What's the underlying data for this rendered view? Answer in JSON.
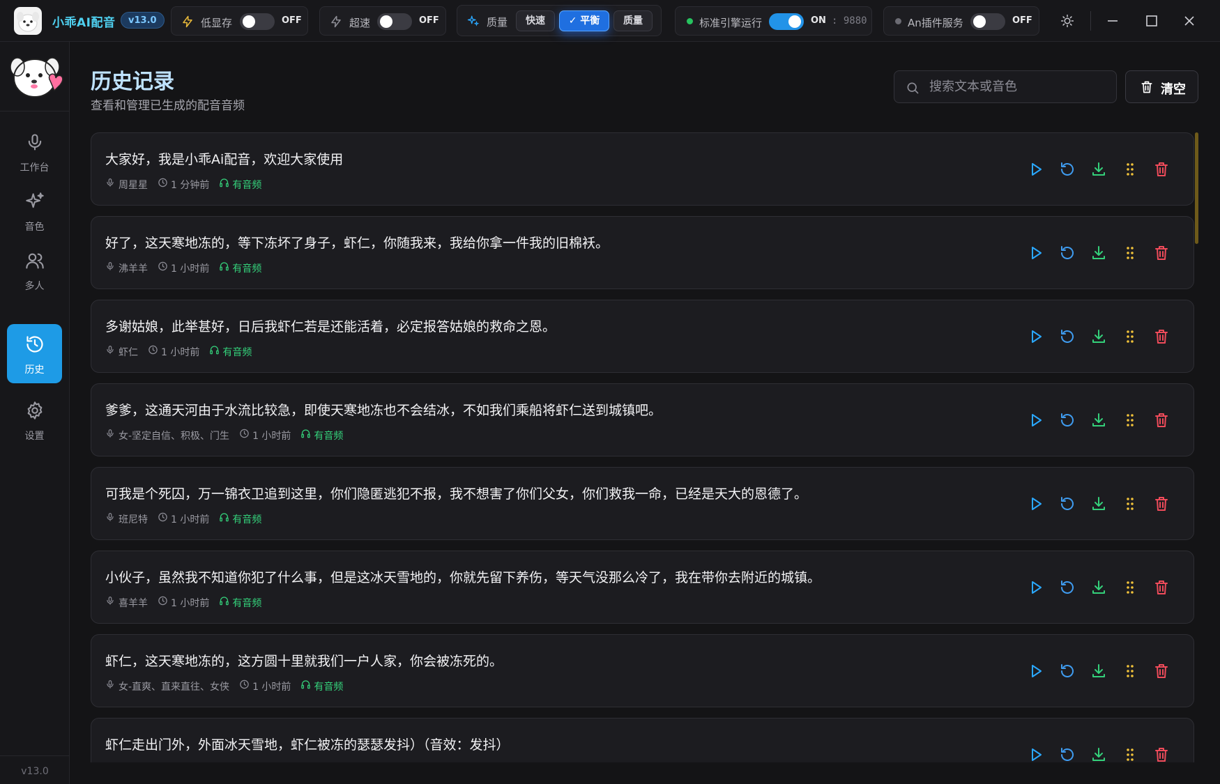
{
  "app": {
    "title": "小乖AI配音",
    "version_badge": "v13.0"
  },
  "toolbar": {
    "low_memory": {
      "label": "低显存",
      "state": "OFF"
    },
    "turbo": {
      "label": "超速",
      "state": "OFF"
    },
    "quality": {
      "label": "质量",
      "options": [
        "快速",
        "✓ 平衡",
        "质量"
      ],
      "selected": "平衡"
    },
    "engine": {
      "label": "标准引擎运行",
      "state": "ON",
      "port": ": 9880",
      "status_color": "#27c35f"
    },
    "plugin": {
      "label": "An插件服务",
      "state": "OFF",
      "status_color": "#6b6b73"
    }
  },
  "sidebar": {
    "items": [
      {
        "label": "工作台",
        "icon": "mic-icon"
      },
      {
        "label": "音色",
        "icon": "sparkles-icon"
      },
      {
        "label": "多人",
        "icon": "users-icon"
      },
      {
        "label": "历史",
        "icon": "history-icon",
        "active": true
      },
      {
        "label": "设置",
        "icon": "gear-icon"
      }
    ],
    "version": "v13.0"
  },
  "header": {
    "title": "历史记录",
    "subtitle": "查看和管理已生成的配音音频",
    "search_placeholder": "搜索文本或音色",
    "clear_label": "清空"
  },
  "history": [
    {
      "text": "大家好，我是小乖Ai配音，欢迎大家使用",
      "voice": "周星星",
      "time": "1 分钟前",
      "status": "有音频"
    },
    {
      "text": "好了，这天寒地冻的，等下冻坏了身子，虾仁，你随我来，我给你拿一件我的旧棉袄。",
      "voice": "沸羊羊",
      "time": "1 小时前",
      "status": "有音频"
    },
    {
      "text": "多谢姑娘，此举甚好，日后我虾仁若是还能活着，必定报答姑娘的救命之恩。",
      "voice": "虾仁",
      "time": "1 小时前",
      "status": "有音频"
    },
    {
      "text": "爹爹，这通天河由于水流比较急，即使天寒地冻也不会结冰，不如我们乘船将虾仁送到城镇吧。",
      "voice": "女-坚定自信、积极、门生",
      "time": "1 小时前",
      "status": "有音频"
    },
    {
      "text": "可我是个死囚，万一锦衣卫追到这里，你们隐匿逃犯不报，我不想害了你们父女，你们救我一命，已经是天大的恩德了。",
      "voice": "班尼特",
      "time": "1 小时前",
      "status": "有音频"
    },
    {
      "text": "小伙子，虽然我不知道你犯了什么事，但是这冰天雪地的，你就先留下养伤，等天气没那么冷了，我在带你去附近的城镇。",
      "voice": "喜羊羊",
      "time": "1 小时前",
      "status": "有音频"
    },
    {
      "text": "虾仁，这天寒地冻的，这方圆十里就我们一户人家，你会被冻死的。",
      "voice": "女-直爽、直来直往、女侠",
      "time": "1 小时前",
      "status": "有音频"
    },
    {
      "text": "虾仁走出门外，外面冰天雪地，虾仁被冻的瑟瑟发抖）（音效：发抖）",
      "voice": "",
      "time": "",
      "status": ""
    }
  ],
  "colors": {
    "accent": "#1e9be6",
    "play": "#2aa8ff",
    "regenerate": "#3f9cf0",
    "download": "#34d07a",
    "drag": "#f0c23a",
    "delete": "#ef4b5a"
  }
}
